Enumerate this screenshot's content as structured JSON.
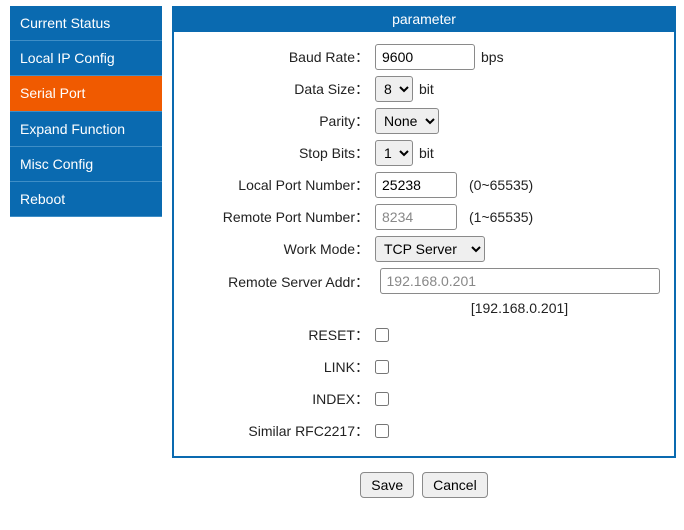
{
  "sidebar": {
    "items": [
      {
        "label": "Current Status"
      },
      {
        "label": "Local IP Config"
      },
      {
        "label": "Serial Port"
      },
      {
        "label": "Expand Function"
      },
      {
        "label": "Misc Config"
      },
      {
        "label": "Reboot"
      }
    ],
    "active_index": 2
  },
  "panel": {
    "title": "parameter"
  },
  "form": {
    "baud_rate": {
      "label": "Baud Rate",
      "value": "9600",
      "unit": "bps"
    },
    "data_size": {
      "label": "Data Size",
      "value": "8",
      "unit": "bit"
    },
    "parity": {
      "label": "Parity",
      "value": "None"
    },
    "stop_bits": {
      "label": "Stop Bits",
      "value": "1",
      "unit": "bit"
    },
    "local_port": {
      "label": "Local Port Number",
      "value": "25238",
      "hint": "(0~65535)"
    },
    "remote_port": {
      "label": "Remote Port Number",
      "value": "8234",
      "hint": "(1~65535)"
    },
    "work_mode": {
      "label": "Work Mode",
      "value": "TCP Server"
    },
    "remote_addr": {
      "label": "Remote Server Addr",
      "value": "192.168.0.201",
      "extra": "[192.168.0.201]"
    },
    "reset": {
      "label": "RESET"
    },
    "link": {
      "label": "LINK"
    },
    "index": {
      "label": "INDEX"
    },
    "rfc2217": {
      "label": "Similar RFC2217"
    }
  },
  "buttons": {
    "save": "Save",
    "cancel": "Cancel"
  }
}
